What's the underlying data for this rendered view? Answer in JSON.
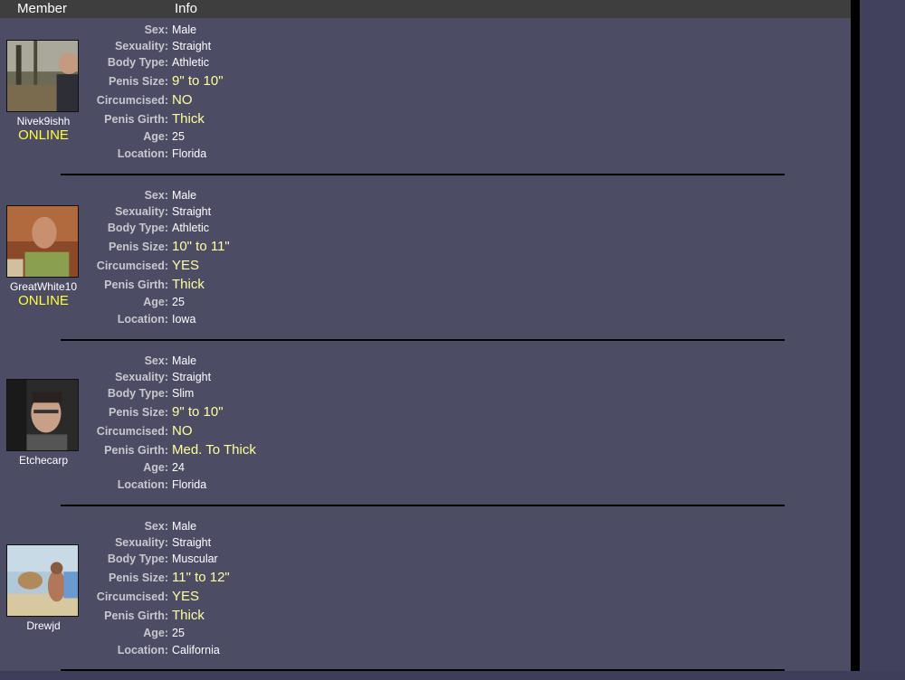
{
  "header": {
    "member": "Member",
    "info": "Info"
  },
  "labels": {
    "sex": "Sex:",
    "sexuality": "Sexuality:",
    "body_type": "Body Type:",
    "penis_size": "Penis Size:",
    "circumcised": "Circumcised:",
    "penis_girth": "Penis Girth:",
    "age": "Age:",
    "location": "Location:"
  },
  "members": [
    {
      "username": "Nivek9ishh",
      "status": "ONLINE",
      "sex": "Male",
      "sexuality": "Straight",
      "body_type": "Athletic",
      "penis_size": "9\" to 10\"",
      "circumcised": "NO",
      "penis_girth": "Thick",
      "age": "25",
      "location": "Florida"
    },
    {
      "username": "GreatWhite10",
      "status": "ONLINE",
      "sex": "Male",
      "sexuality": "Straight",
      "body_type": "Athletic",
      "penis_size": "10\" to 11\"",
      "circumcised": "YES",
      "penis_girth": "Thick",
      "age": "25",
      "location": "Iowa"
    },
    {
      "username": "Etchecarp",
      "status": "",
      "sex": "Male",
      "sexuality": "Straight",
      "body_type": "Slim",
      "penis_size": "9\" to 10\"",
      "circumcised": "NO",
      "penis_girth": "Med. To Thick",
      "age": "24",
      "location": "Florida"
    },
    {
      "username": "Drewjd",
      "status": "",
      "sex": "Male",
      "sexuality": "Straight",
      "body_type": "Muscular",
      "penis_size": "11\" to 12\"",
      "circumcised": "YES",
      "penis_girth": "Thick",
      "age": "25",
      "location": "California"
    }
  ],
  "colors": {
    "background": "#4d4c65",
    "header": "#3e3e3e",
    "online": "#ffff33",
    "highlight_value": "#ffff99",
    "label": "#c8c8cc"
  }
}
